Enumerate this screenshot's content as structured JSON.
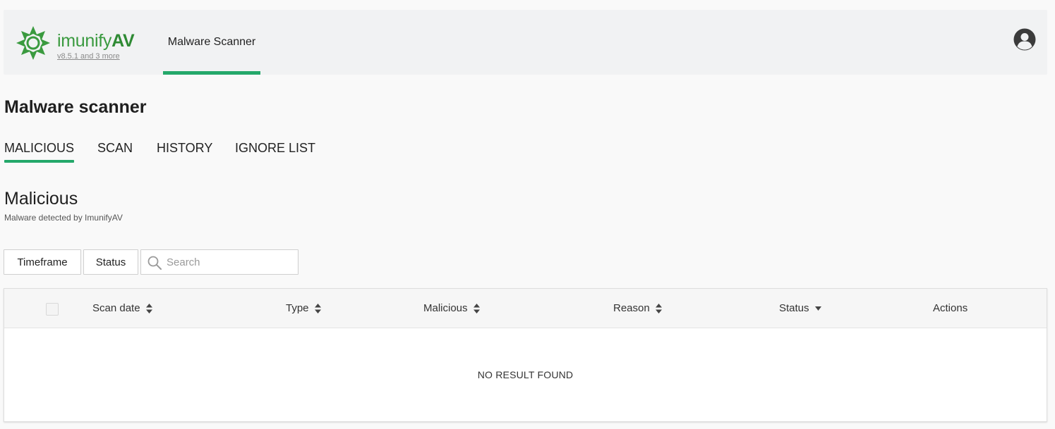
{
  "header": {
    "brand_light": "imunify",
    "brand_bold": "AV",
    "version": "v8.5.1 and 3 more",
    "nav_tab": "Malware Scanner",
    "accent_color": "#24a86a",
    "logo_icon": "imunify-logo-icon",
    "avatar_icon": "user-avatar-icon"
  },
  "page": {
    "title": "Malware scanner",
    "tabs": [
      {
        "label": "MALICIOUS",
        "active": true
      },
      {
        "label": "SCAN",
        "active": false
      },
      {
        "label": "HISTORY",
        "active": false
      },
      {
        "label": "IGNORE LIST",
        "active": false
      }
    ]
  },
  "section": {
    "title": "Malicious",
    "subtitle": "Malware detected by ImunifyAV"
  },
  "filters": {
    "timeframe_label": "Timeframe",
    "status_label": "Status",
    "search_placeholder": "Search",
    "search_value": ""
  },
  "table": {
    "columns": [
      {
        "label": "Scan date",
        "sort": "both"
      },
      {
        "label": "Type",
        "sort": "both"
      },
      {
        "label": "Malicious",
        "sort": "both"
      },
      {
        "label": "Reason",
        "sort": "both"
      },
      {
        "label": "Status",
        "sort": "down"
      },
      {
        "label": "Actions",
        "sort": "none"
      }
    ],
    "empty_text": "NO RESULT FOUND"
  }
}
